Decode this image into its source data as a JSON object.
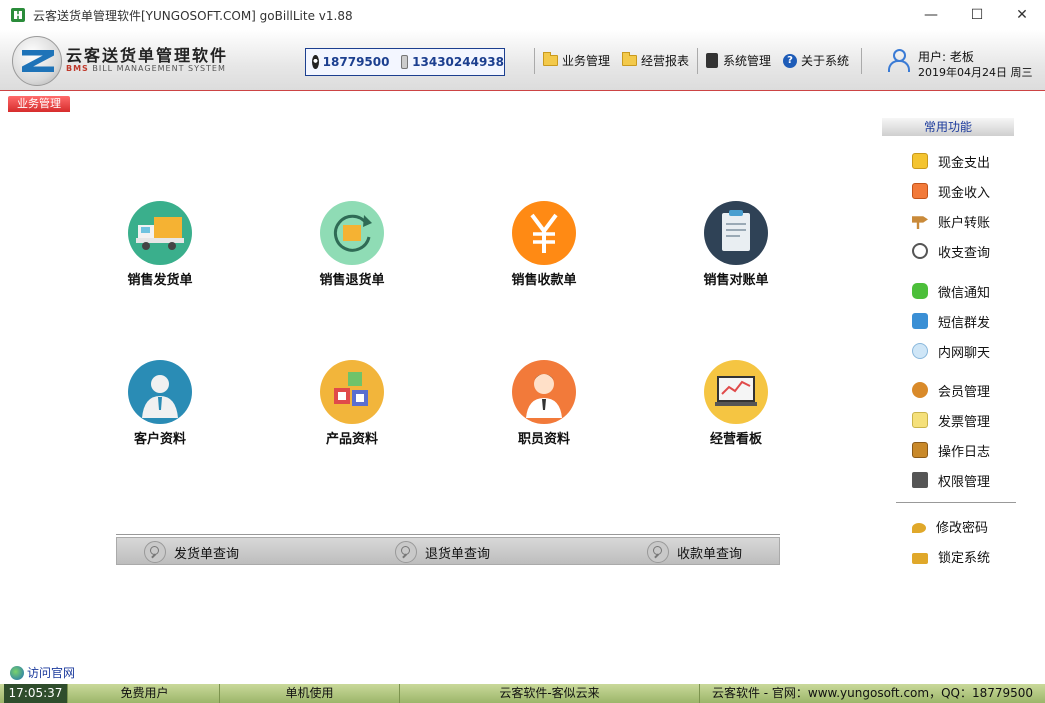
{
  "window": {
    "title": "云客送货单管理软件[YUNGOSOFT.COM]  goBillLite v1.88",
    "controls": {
      "minimize": "—",
      "maximize": "☐",
      "close": "✕"
    }
  },
  "header": {
    "logo_title": "云客送货单管理软件",
    "logo_sub_prefix": "BMS",
    "logo_sub": " BILL MANAGEMENT SYSTEM",
    "contact": {
      "qq": "18779500",
      "phone": "13430244938"
    },
    "menu": [
      {
        "label": "业务管理",
        "icon": "folder-icon"
      },
      {
        "label": "经营报表",
        "icon": "folder-icon"
      },
      {
        "label": "系统管理",
        "icon": "system-icon"
      },
      {
        "label": "关于系统",
        "icon": "help-icon"
      }
    ],
    "user": {
      "name": "用户: 老板",
      "date": "2019年04月24日  周三"
    }
  },
  "tab": {
    "label": "业务管理"
  },
  "tiles": [
    {
      "label": "销售发货单",
      "icon": "truck-icon",
      "color": "#3aaf8c"
    },
    {
      "label": "销售退货单",
      "icon": "return-icon",
      "color": "#8fdcb5"
    },
    {
      "label": "销售收款单",
      "icon": "yen-icon",
      "color": "#ff8a14"
    },
    {
      "label": "销售对账单",
      "icon": "clipboard-icon",
      "color": "#2f4256"
    },
    {
      "label": "客户资料",
      "icon": "customer-icon",
      "color": "#2a8cb5"
    },
    {
      "label": "产品资料",
      "icon": "boxes-icon",
      "color": "#f2b53b"
    },
    {
      "label": "职员资料",
      "icon": "staff-icon",
      "color": "#f27a3a"
    },
    {
      "label": "经营看板",
      "icon": "dashboard-icon",
      "color": "#f5c542"
    }
  ],
  "queries": [
    {
      "label": "发货单查询"
    },
    {
      "label": "退货单查询"
    },
    {
      "label": "收款单查询"
    }
  ],
  "sidebar": {
    "title": "常用功能",
    "items": [
      {
        "label": "现金支出",
        "icon": "cash-out-icon",
        "color": "#f4c430"
      },
      {
        "label": "现金收入",
        "icon": "cash-in-icon",
        "color": "#f27a3a"
      },
      {
        "label": "账户转账",
        "icon": "transfer-icon",
        "color": "#c98a3a"
      },
      {
        "label": "收支查询",
        "icon": "query-icon",
        "color": "#666666"
      },
      {
        "label": "微信通知",
        "icon": "wechat-icon",
        "color": "#4cbf3a"
      },
      {
        "label": "短信群发",
        "icon": "sms-icon",
        "color": "#3a8fd5"
      },
      {
        "label": "内网聊天",
        "icon": "chat-icon",
        "color": "#a9d2f0"
      },
      {
        "label": "会员管理",
        "icon": "member-icon",
        "color": "#d98a2a"
      },
      {
        "label": "发票管理",
        "icon": "invoice-icon",
        "color": "#f5e07a"
      },
      {
        "label": "操作日志",
        "icon": "log-icon",
        "color": "#c9892a"
      },
      {
        "label": "权限管理",
        "icon": "permission-icon",
        "color": "#555555"
      },
      {
        "label": "修改密码",
        "icon": "key-icon",
        "color": "#e0a82a"
      },
      {
        "label": "锁定系统",
        "icon": "lock-icon",
        "color": "#e0a82a"
      }
    ]
  },
  "visit_link": "访问官网",
  "status": {
    "clock": "17:05:37",
    "cells": [
      "免费用户",
      "单机使用",
      "云客软件-客似云来",
      "云客软件 - 官网：www.yungosoft.com，QQ：18779500"
    ]
  }
}
